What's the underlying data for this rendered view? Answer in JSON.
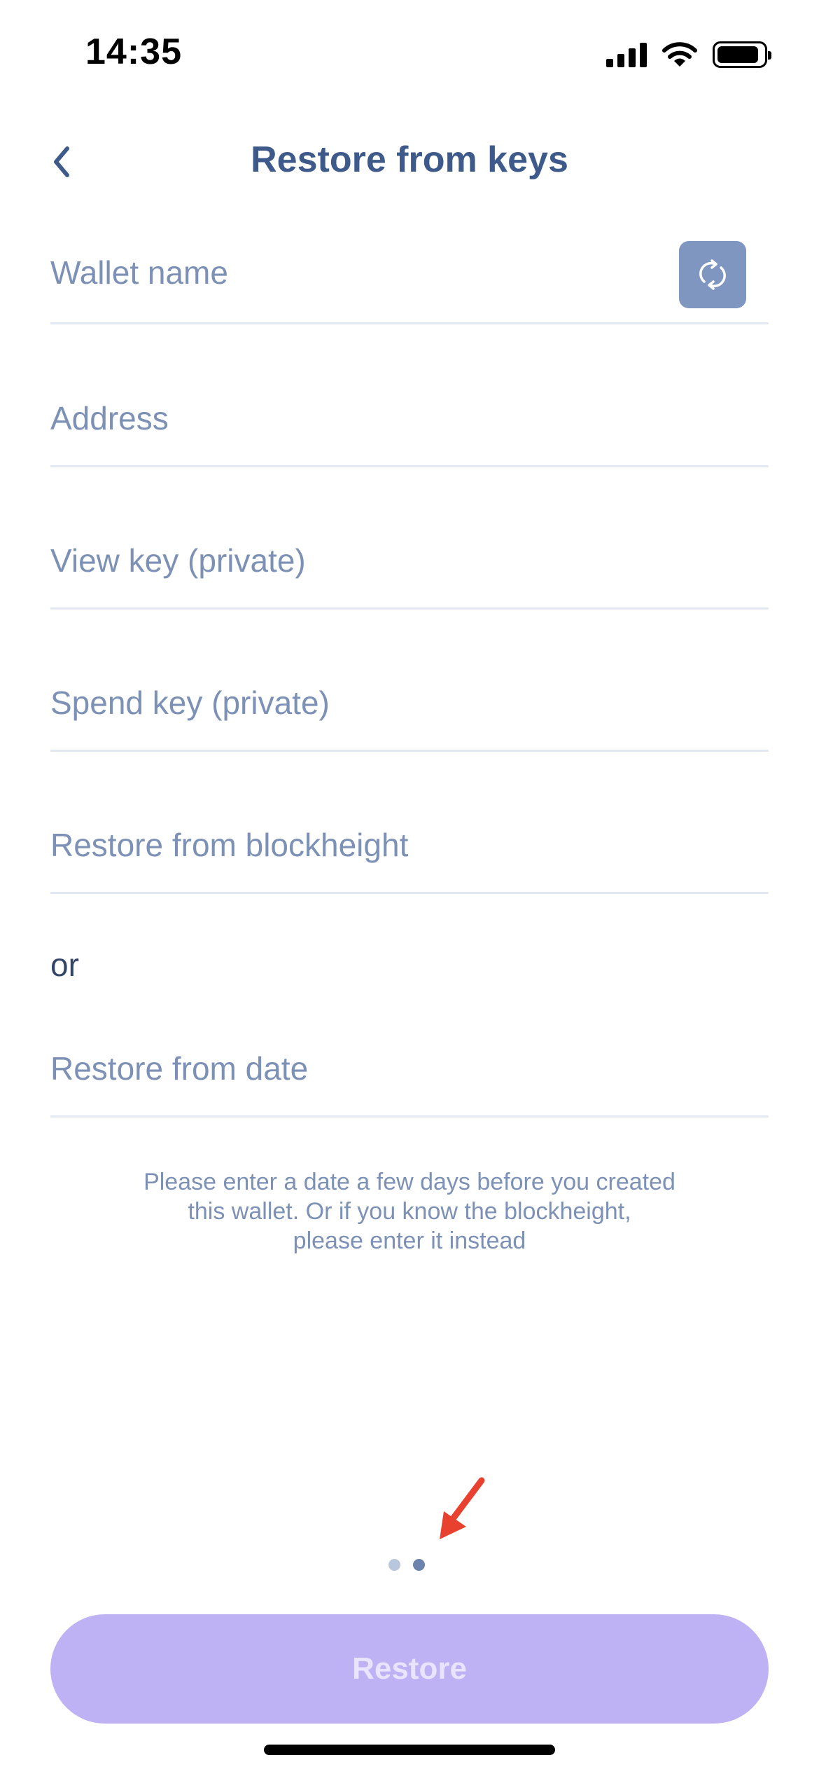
{
  "status_bar": {
    "time": "14:35"
  },
  "header": {
    "title": "Restore from keys",
    "back_icon": "chevron-left-icon"
  },
  "fields": {
    "wallet_name": {
      "label": "Wallet name",
      "action_icon": "refresh-icon"
    },
    "address": {
      "label": "Address"
    },
    "view_key": {
      "label": "View key (private)"
    },
    "spend_key": {
      "label": "Spend key (private)"
    },
    "blockheight": {
      "label": "Restore from blockheight"
    },
    "date": {
      "label": "Restore from date"
    }
  },
  "separator_text": "or",
  "hint": "Please enter a date a few days before you created\nthis wallet. Or if you know the blockheight,\nplease enter it instead",
  "page_indicator": {
    "total": 2,
    "active": 2
  },
  "restore_button": {
    "label": "Restore",
    "background": "#beb1f4"
  },
  "colors": {
    "accent": "#3d5a8a",
    "label": "#7c91b5",
    "arrow": "#e8412f"
  }
}
